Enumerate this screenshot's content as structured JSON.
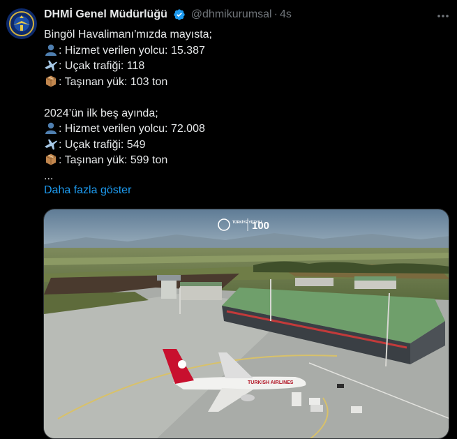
{
  "author": {
    "name": "DHMİ Genel Müdürlüğü",
    "handle": "@dhmikurumsal",
    "separator": "·",
    "time": "4s",
    "avatar_icon": "dhmi-logo-icon"
  },
  "text": {
    "line1": "Bingöl Havalimanı’mızda mayısta;",
    "line2": ": Hizmet verilen yolcu: 15.387",
    "line3": ": Uçak trafiği: 118",
    "line4": ": Taşınan yük: 103 ton",
    "line5": "2024’ün ilk beş ayında;",
    "line6": ": Hizmet verilen yolcu: 72.008",
    "line7": ": Uçak trafiği: 549",
    "line8": ": Taşınan yük: 599 ton",
    "line9": "..."
  },
  "show_more": "Daha fazla göster",
  "media": {
    "airline_text": "TURKISH AIRLINES",
    "watermark_text": "TÜRKİYE YÜZYILI",
    "watermark_100": "100"
  },
  "icons": {
    "passenger": "bust-in-silhouette-icon",
    "plane": "airplane-icon",
    "cargo": "package-icon",
    "verified": "verified-badge-icon",
    "more": "more-options-icon"
  },
  "colors": {
    "background": "#000000",
    "text": "#e7e9ea",
    "secondary": "#71767b",
    "link": "#1d9bf0"
  }
}
